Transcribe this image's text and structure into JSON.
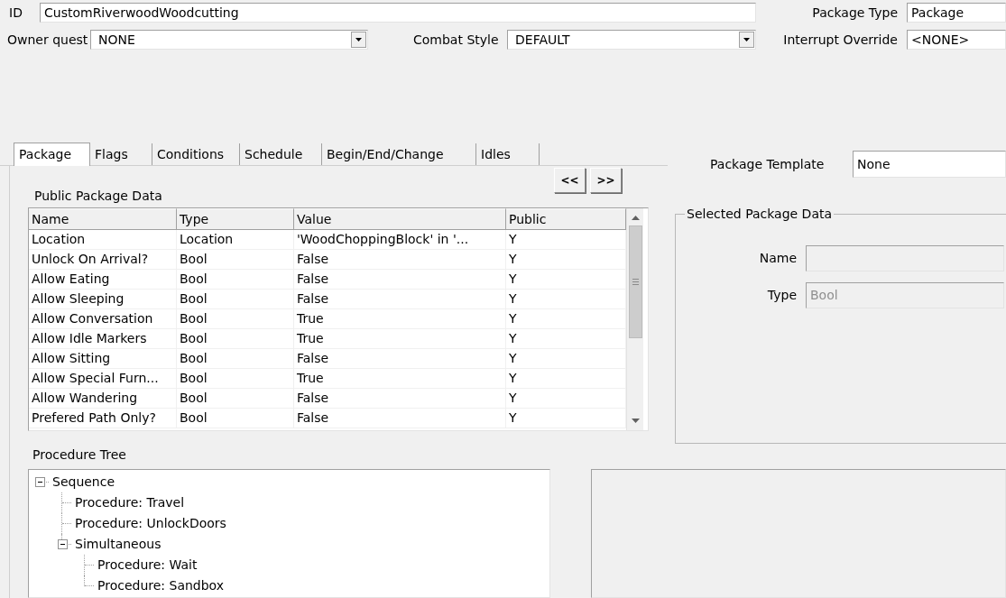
{
  "id_field": {
    "label": "ID",
    "value": "CustomRiverwoodWoodcutting"
  },
  "package_type": {
    "label": "Package Type",
    "value": "Package"
  },
  "owner_quest": {
    "label": "Owner quest",
    "value": "NONE"
  },
  "combat_style": {
    "label": "Combat Style",
    "value": "DEFAULT"
  },
  "interrupt_override": {
    "label": "Interrupt Override",
    "value": "<NONE>"
  },
  "tabs": [
    {
      "label": "Package",
      "selected": true
    },
    {
      "label": "Flags",
      "selected": false
    },
    {
      "label": "Conditions",
      "selected": false
    },
    {
      "label": "Schedule",
      "selected": false
    },
    {
      "label": "Begin/End/Change",
      "selected": false
    },
    {
      "label": "Idles",
      "selected": false
    }
  ],
  "public_package_data": {
    "title": "Public Package Data",
    "nav_buttons": [
      "<<",
      ">>"
    ],
    "columns": [
      "Name",
      "Type",
      "Value",
      "Public"
    ],
    "rows": [
      [
        "Location",
        "Location",
        "'WoodChoppingBlock' in '...",
        "Y"
      ],
      [
        "Unlock On Arrival?",
        "Bool",
        "False",
        "Y"
      ],
      [
        "Allow Eating",
        "Bool",
        "False",
        "Y"
      ],
      [
        "Allow Sleeping",
        "Bool",
        "False",
        "Y"
      ],
      [
        "Allow Conversation",
        "Bool",
        "True",
        "Y"
      ],
      [
        "Allow Idle Markers",
        "Bool",
        "True",
        "Y"
      ],
      [
        "Allow Sitting",
        "Bool",
        "False",
        "Y"
      ],
      [
        "Allow Special Furn...",
        "Bool",
        "True",
        "Y"
      ],
      [
        "Allow Wandering",
        "Bool",
        "False",
        "Y"
      ],
      [
        "Prefered Path Only?",
        "Bool",
        "False",
        "Y"
      ]
    ]
  },
  "package_template": {
    "label": "Package Template",
    "value": "None"
  },
  "selected_package_data": {
    "title": "Selected Package Data",
    "fields": [
      {
        "label": "Name",
        "disabled": true
      },
      {
        "label": "Type",
        "value": "Bool",
        "disabled": true
      }
    ]
  },
  "procedure_tree": {
    "title": "Procedure Tree",
    "nodes": [
      {
        "label": "Sequence",
        "expanded": true,
        "children": [
          {
            "label": "Procedure: Travel"
          },
          {
            "label": "Procedure: UnlockDoors"
          },
          {
            "label": "Simultaneous",
            "expanded": true,
            "children": [
              {
                "label": "Procedure: Wait"
              },
              {
                "label": "Procedure: Sandbox"
              }
            ]
          }
        ]
      }
    ]
  }
}
